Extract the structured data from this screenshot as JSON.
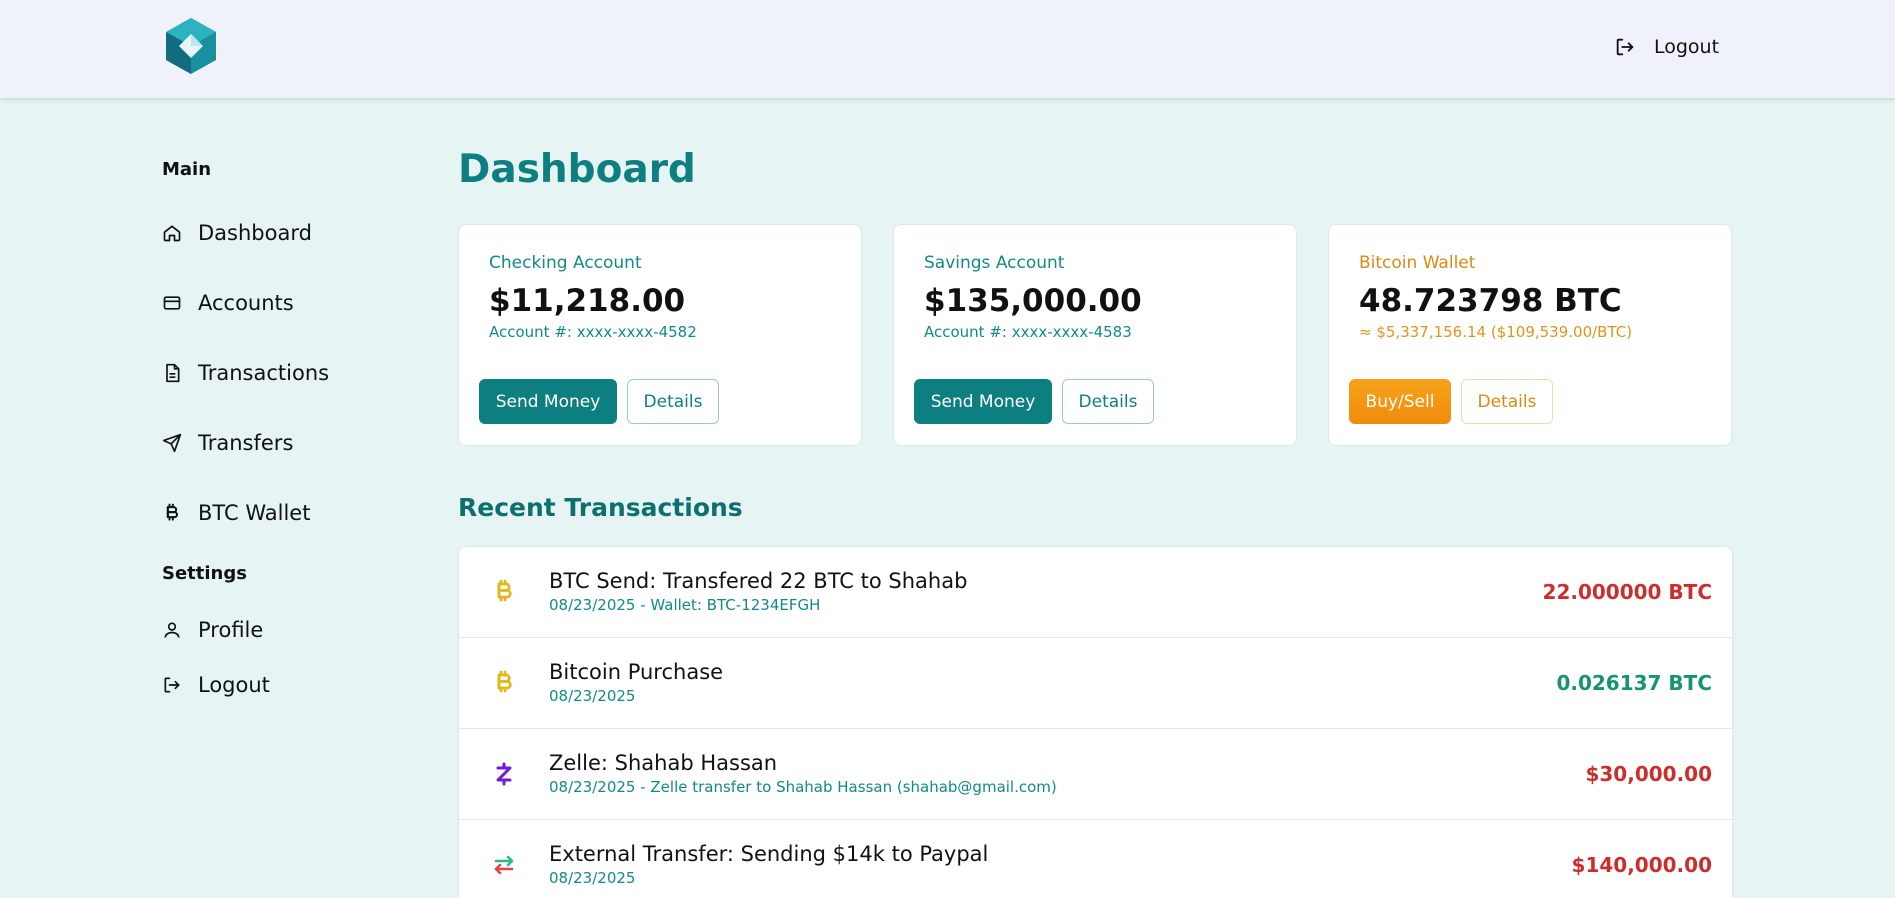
{
  "header": {
    "logout_label": "Logout"
  },
  "sidebar": {
    "main_label": "Main",
    "items": [
      {
        "label": "Dashboard",
        "icon": "home-icon"
      },
      {
        "label": "Accounts",
        "icon": "card-icon"
      },
      {
        "label": "Transactions",
        "icon": "document-icon"
      },
      {
        "label": "Transfers",
        "icon": "send-icon"
      },
      {
        "label": "BTC Wallet",
        "icon": "bitcoin-icon"
      }
    ],
    "settings_label": "Settings",
    "settings_items": [
      {
        "label": "Profile",
        "icon": "user-icon"
      },
      {
        "label": "Logout",
        "icon": "logout-icon"
      }
    ]
  },
  "main": {
    "title": "Dashboard",
    "cards": [
      {
        "title": "Checking Account",
        "amount": "$11,218.00",
        "sub": "Account #: xxxx-xxxx-4582",
        "primary_label": "Send Money",
        "secondary_label": "Details"
      },
      {
        "title": "Savings Account",
        "amount": "$135,000.00",
        "sub": "Account #: xxxx-xxxx-4583",
        "primary_label": "Send Money",
        "secondary_label": "Details"
      },
      {
        "title": "Bitcoin Wallet",
        "amount": "48.723798 BTC",
        "sub": "≈ $5,337,156.14 ($109,539.00/BTC)",
        "primary_label": "Buy/Sell",
        "secondary_label": "Details"
      }
    ],
    "recent_title": "Recent Transactions",
    "transactions": [
      {
        "title": "BTC Send: Transfered 22 BTC to Shahab",
        "sub": "08/23/2025 - Wallet: BTC-1234EFGH",
        "amount": "22.000000 BTC",
        "type": "negative",
        "icon": "bitcoin-icon"
      },
      {
        "title": "Bitcoin Purchase",
        "sub": "08/23/2025",
        "amount": "0.026137 BTC",
        "type": "positive",
        "icon": "bitcoin-icon"
      },
      {
        "title": "Zelle: Shahab Hassan",
        "sub": "08/23/2025 - Zelle transfer to Shahab Hassan (shahab@gmail.com)",
        "amount": "$30,000.00",
        "type": "negative",
        "icon": "zelle-icon"
      },
      {
        "title": "External Transfer: Sending $14k to Paypal",
        "sub": "08/23/2025",
        "amount": "$140,000.00",
        "type": "negative",
        "icon": "transfer-arrows-icon"
      }
    ]
  },
  "colors": {
    "accent": "#0d7f80",
    "btc": "#f08c0c",
    "negative": "#cc2e2e",
    "positive": "#16946e",
    "background": "#e6f4f3"
  }
}
